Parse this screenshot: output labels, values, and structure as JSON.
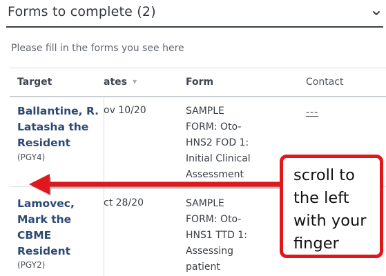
{
  "header": {
    "title": "Forms to complete (2)",
    "toggle_icon": "chevron-down-icon"
  },
  "subtitle": "Please fill in the forms you see here",
  "table": {
    "columns": {
      "target": "Target",
      "dates": "ates",
      "form": "Form",
      "contact": "Contact"
    },
    "sort_icon": "sort-desc-icon",
    "rows": [
      {
        "target_lines": [
          "Ballantine, R.",
          "Latasha the",
          "Resident"
        ],
        "pgy": "(PGY4)",
        "date": "ov 10/20",
        "form_lines": [
          "SAMPLE",
          "FORM: Oto-",
          "HNS2 FOD 1:",
          "Initial Clinical",
          "Assessment"
        ],
        "contact": "---"
      },
      {
        "target_lines": [
          "Lamovec,",
          "Mark the",
          "CBME",
          "Resident"
        ],
        "pgy": "(PGY2)",
        "date": "ct 28/20",
        "form_lines": [
          "SAMPLE",
          "FORM: Oto-",
          "HNS1 TTD 1:",
          "Assessing",
          "patient"
        ],
        "contact": ""
      }
    ]
  },
  "annotation": {
    "lines": [
      "scroll to",
      "the left",
      "with your",
      "finger"
    ],
    "color": "#e0181c",
    "arrow_icon": "left-arrow-icon"
  }
}
